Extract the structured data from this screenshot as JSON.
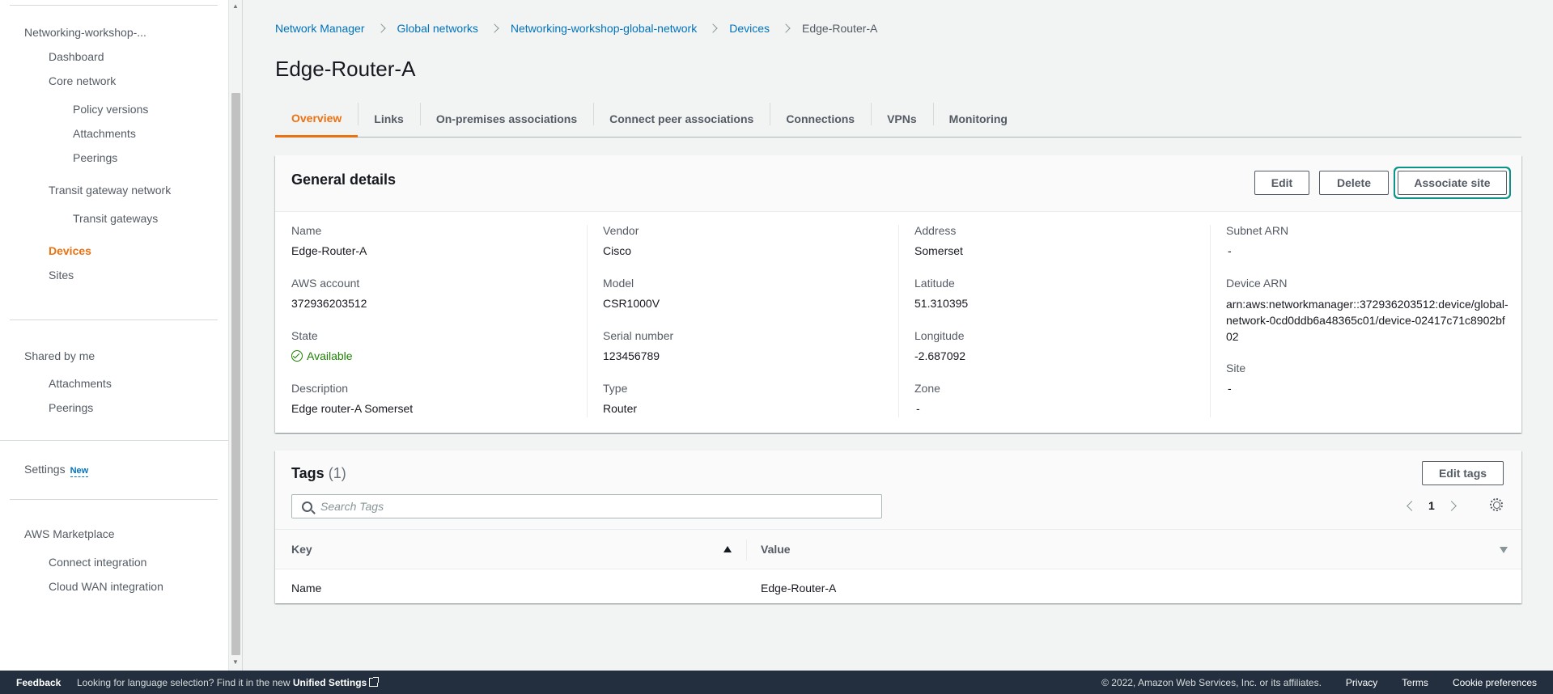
{
  "sidebar": {
    "network_name": "Networking-workshop-...",
    "items": [
      {
        "label": "Dashboard"
      },
      {
        "label": "Core network"
      },
      {
        "label": "Policy versions"
      },
      {
        "label": "Attachments"
      },
      {
        "label": "Peerings"
      },
      {
        "label": "Transit gateway network"
      },
      {
        "label": "Transit gateways"
      },
      {
        "label": "Devices"
      },
      {
        "label": "Sites"
      }
    ],
    "shared_section": "Shared by me",
    "shared_items": [
      {
        "label": "Attachments"
      },
      {
        "label": "Peerings"
      }
    ],
    "settings_label": "Settings",
    "settings_badge": "New",
    "marketplace_section": "AWS Marketplace",
    "marketplace_items": [
      {
        "label": "Connect integration"
      },
      {
        "label": "Cloud WAN integration"
      }
    ]
  },
  "breadcrumb": [
    {
      "label": "Network Manager"
    },
    {
      "label": "Global networks"
    },
    {
      "label": "Networking-workshop-global-network"
    },
    {
      "label": "Devices"
    },
    {
      "label": "Edge-Router-A"
    }
  ],
  "page_title": "Edge-Router-A",
  "tabs": [
    {
      "label": "Overview",
      "active": true
    },
    {
      "label": "Links"
    },
    {
      "label": "On-premises associations"
    },
    {
      "label": "Connect peer associations"
    },
    {
      "label": "Connections"
    },
    {
      "label": "VPNs"
    },
    {
      "label": "Monitoring"
    }
  ],
  "general": {
    "title": "General details",
    "edit_label": "Edit",
    "delete_label": "Delete",
    "associate_label": "Associate site",
    "fields": {
      "name_label": "Name",
      "name_value": "Edge-Router-A",
      "account_label": "AWS account",
      "account_value": "372936203512",
      "state_label": "State",
      "state_value": "Available",
      "description_label": "Description",
      "description_value": "Edge router-A Somerset",
      "vendor_label": "Vendor",
      "vendor_value": "Cisco",
      "model_label": "Model",
      "model_value": "CSR1000V",
      "serial_label": "Serial number",
      "serial_value": "123456789",
      "type_label": "Type",
      "type_value": "Router",
      "address_label": "Address",
      "address_value": "Somerset",
      "latitude_label": "Latitude",
      "latitude_value": "51.310395",
      "longitude_label": "Longitude",
      "longitude_value": "-2.687092",
      "zone_label": "Zone",
      "zone_value": "-",
      "subnet_label": "Subnet ARN",
      "subnet_value": "-",
      "device_arn_label": "Device ARN",
      "device_arn_value": "arn:aws:networkmanager::372936203512:device/global-network-0cd0ddb6a48365c01/device-02417c71c8902bf02",
      "site_label": "Site",
      "site_value": "-"
    }
  },
  "tags": {
    "title": "Tags",
    "count": "(1)",
    "edit_label": "Edit tags",
    "search_placeholder": "Search Tags",
    "page": "1",
    "columns": [
      "Key",
      "Value"
    ],
    "rows": [
      {
        "key": "Name",
        "value": "Edge-Router-A"
      }
    ]
  },
  "footer": {
    "feedback": "Feedback",
    "lang_text": "Looking for language selection? Find it in the new",
    "lang_link": "Unified Settings",
    "copyright": "© 2022, Amazon Web Services, Inc. or its affiliates.",
    "privacy": "Privacy",
    "terms": "Terms",
    "cookies": "Cookie preferences"
  },
  "colors": {
    "accent": "#ec7211",
    "link": "#0073bb",
    "success": "#1d8102",
    "footer_bg": "#232f3e"
  }
}
